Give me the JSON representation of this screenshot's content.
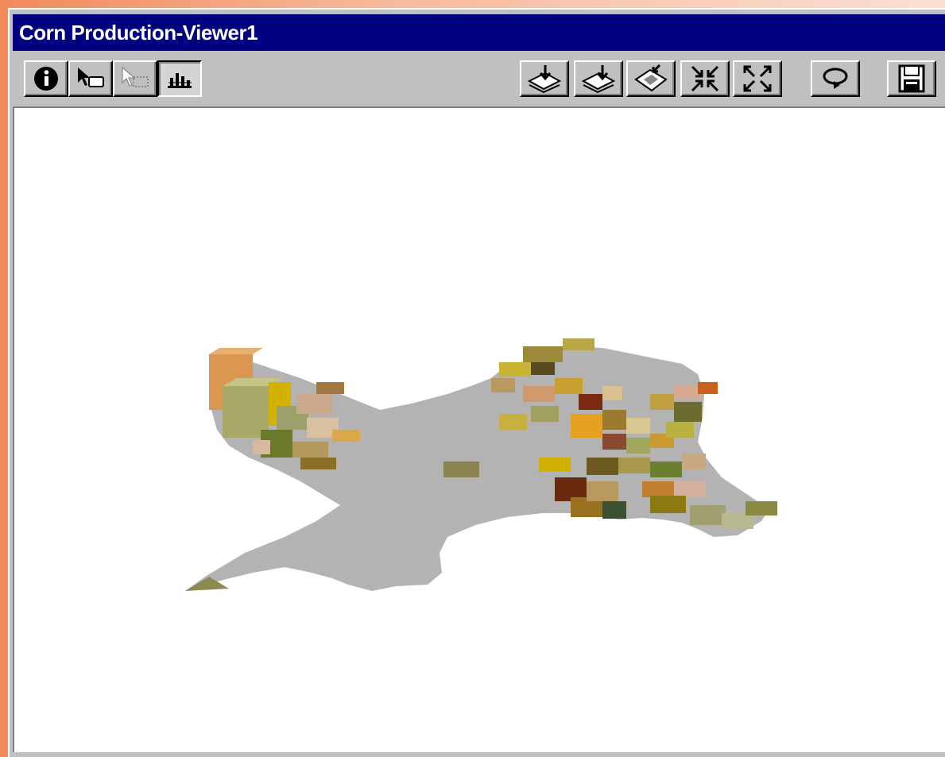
{
  "window": {
    "title": "Corn Production-Viewer1"
  },
  "toolbar": {
    "left_tools": [
      {
        "name": "info-icon"
      },
      {
        "name": "select-pointer-icon"
      },
      {
        "name": "select-area-icon"
      },
      {
        "name": "navigate-3d-icon"
      }
    ],
    "right_tools": [
      {
        "name": "add-theme-icon"
      },
      {
        "name": "add-layer-icon"
      },
      {
        "name": "zoom-to-theme-icon"
      },
      {
        "name": "zoom-in-icon"
      },
      {
        "name": "zoom-out-icon"
      },
      {
        "name": "rotate-icon"
      },
      {
        "name": "save-icon"
      }
    ]
  },
  "colors": {
    "titlebar": "#000080",
    "face": "#c0c0c0",
    "state_base": "#b3b3b3"
  }
}
